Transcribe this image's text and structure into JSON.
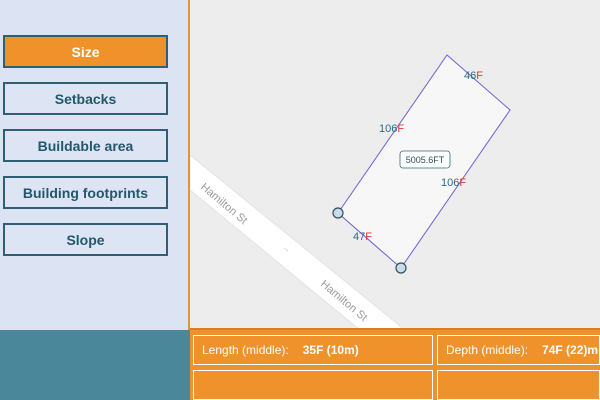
{
  "sidebar": {
    "items": [
      {
        "label": "Size",
        "active": true
      },
      {
        "label": "Setbacks",
        "active": false
      },
      {
        "label": "Buildable area",
        "active": false
      },
      {
        "label": "Building footprints",
        "active": false
      },
      {
        "label": "Slope",
        "active": false
      }
    ]
  },
  "map": {
    "street_name_1": "Hamilton St",
    "street_name_2": "Hamilton St",
    "street_arrow": "→",
    "area_label": "5005.6FT",
    "dimensions": [
      {
        "value": "46",
        "unit": "F"
      },
      {
        "value": "106",
        "unit": "F"
      },
      {
        "value": "106",
        "unit": "F"
      },
      {
        "value": "47",
        "unit": "F"
      }
    ]
  },
  "info": {
    "length_label": "Length (middle):",
    "length_value": "35F (10m)",
    "depth_label": "Depth (middle):",
    "depth_value": "74F (22)m"
  },
  "colors": {
    "accent": "#f0922c",
    "sidebar_bg": "#dce4f3",
    "bottom_left_bg": "#4a879a",
    "lot_outline": "#6b5fd6",
    "dimension_unit": "#d8383a",
    "dimension_value": "#2c6a80"
  }
}
